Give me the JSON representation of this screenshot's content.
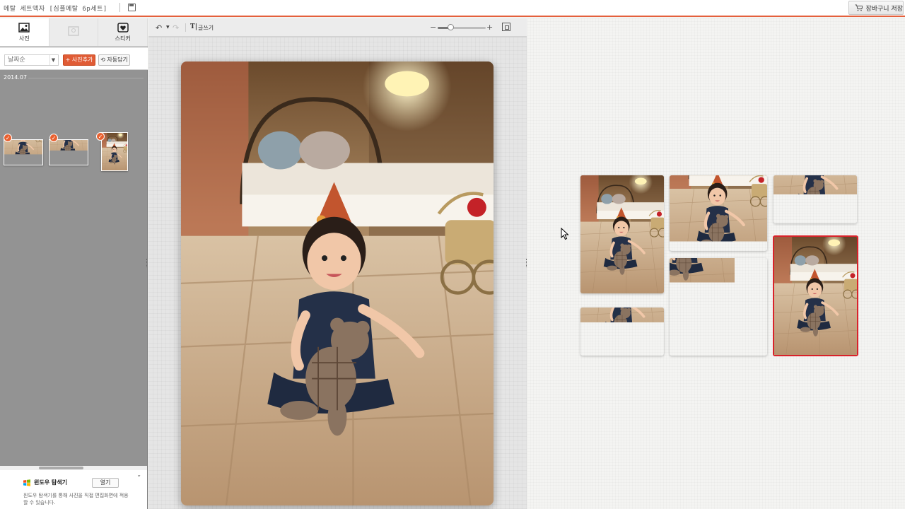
{
  "app": {
    "doc_title": "메탈 세트액자 [심플메탈 6p세트]",
    "cart_label": "장바구니 저장"
  },
  "left_panel": {
    "tabs": [
      {
        "label": "사진",
        "icon": "photo-icon"
      },
      {
        "label": "",
        "icon": "frame-icon"
      },
      {
        "label": "스티커",
        "icon": "sticker-icon"
      }
    ],
    "sort": {
      "selected": "날짜순"
    },
    "add_photo_label": "+ 사진추가",
    "autofill_label": "⟲ 자동담기",
    "date_group": "2014.07",
    "thumbnails": [
      {
        "name": "baby-waving",
        "checked": true
      },
      {
        "name": "baby-crawling",
        "checked": true
      },
      {
        "name": "baby-bed-portrait",
        "checked": true
      }
    ],
    "explorer": {
      "title": "윈도우 탐색기",
      "open_label": "열기",
      "desc": "윈도우 탐색기를 통해 사진을 직접 편집화면에 적용할 수 있습니다.",
      "collapse_icon": "chevron-down-icon"
    }
  },
  "editor": {
    "text_tool_label": "글쓰기",
    "text_tool_icon": "text-tool-icon",
    "undo_icon": "undo-icon",
    "redo_icon": "redo-icon",
    "zoom_level": 0.27,
    "fit_icon": "fit-screen-icon"
  },
  "layout_panel": {
    "selected_slot": 6,
    "slots": 6
  },
  "colors": {
    "accent": "#e05c36",
    "selected_border": "#d9222a",
    "panel_gray": "#939393"
  }
}
